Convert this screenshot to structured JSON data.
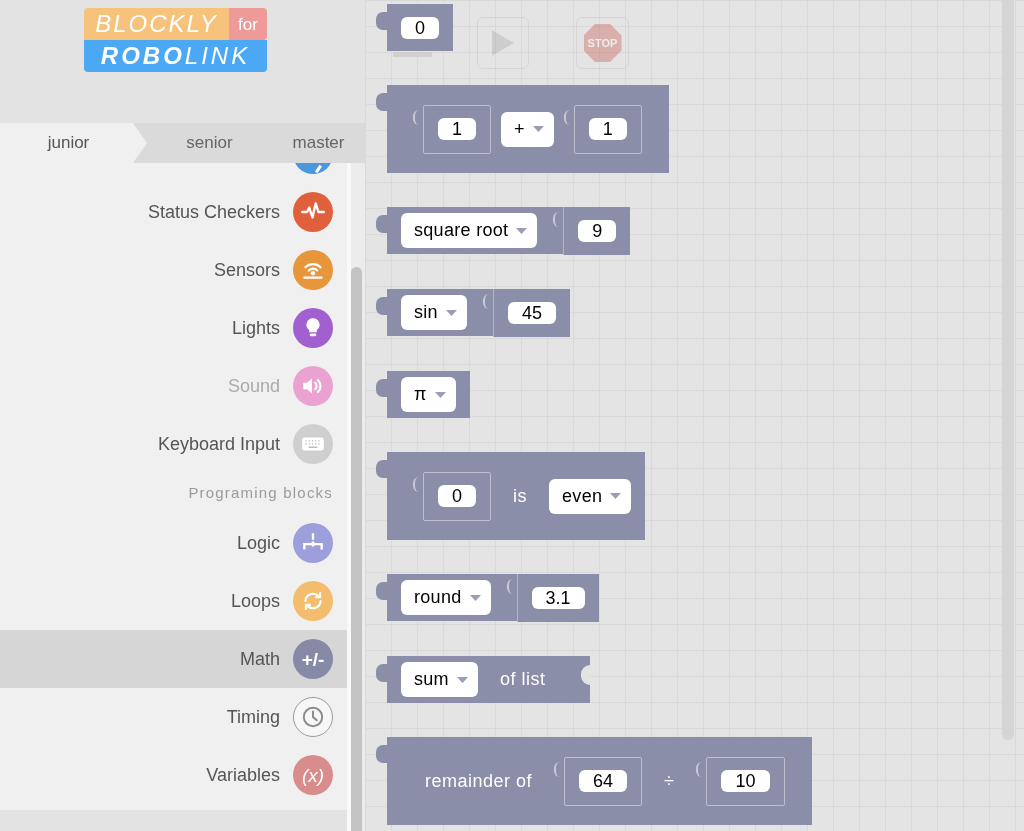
{
  "logo": {
    "top": "BLOCKLY",
    "badge": "for",
    "bottom": "**ROBO**LINK"
  },
  "tabs": [
    {
      "label": "junior",
      "selected": true
    },
    {
      "label": "senior",
      "selected": false
    },
    {
      "label": "master",
      "selected": false
    }
  ],
  "categories": [
    {
      "kind": "clipped",
      "color": "#4c96dd"
    },
    {
      "kind": "item",
      "label": "Status Checkers",
      "color": "#e0603b",
      "selected": false,
      "disabled": false
    },
    {
      "kind": "item",
      "label": "Sensors",
      "color": "#e8963c",
      "selected": false,
      "disabled": false
    },
    {
      "kind": "item",
      "label": "Lights",
      "color": "#a15fd0",
      "selected": false,
      "disabled": false
    },
    {
      "kind": "item",
      "label": "Sound",
      "color": "#eaa3d0",
      "selected": false,
      "disabled": true
    },
    {
      "kind": "item",
      "label": "Keyboard Input",
      "color": "#cfcfcf",
      "selected": false,
      "disabled": false
    },
    {
      "kind": "header",
      "label": "Programing blocks"
    },
    {
      "kind": "item",
      "label": "Logic",
      "color": "#9c9fdb",
      "selected": false,
      "disabled": false
    },
    {
      "kind": "item",
      "label": "Loops",
      "color": "#f3bd6d",
      "selected": false,
      "disabled": false
    },
    {
      "kind": "item",
      "label": "Math",
      "color": "#878aa6",
      "icon_text": "+/-",
      "selected": true,
      "disabled": false
    },
    {
      "kind": "item",
      "label": "Timing",
      "color": "#f7f7f7",
      "selected": false,
      "disabled": false
    },
    {
      "kind": "item",
      "label": "Variables",
      "color": "#d88c8c",
      "icon_text": "(x)",
      "selected": false,
      "disabled": false
    }
  ],
  "toolbar": {
    "play": {
      "disabled": true
    },
    "stop": {
      "label": "STOP",
      "disabled": true
    }
  },
  "blocks": [
    {
      "parts": [
        {
          "kind": "field",
          "text": "0"
        }
      ]
    },
    {
      "parts": [
        {
          "kind": "socket",
          "value": "1"
        },
        {
          "kind": "dropdown",
          "text": "+"
        },
        {
          "kind": "socket",
          "value": "1"
        }
      ]
    },
    {
      "parts": [
        {
          "kind": "dropdown",
          "text": "square root"
        }
      ],
      "attached": "9"
    },
    {
      "parts": [
        {
          "kind": "dropdown",
          "text": "sin"
        }
      ],
      "attached": "45"
    },
    {
      "parts": [
        {
          "kind": "dropdown",
          "text": "π"
        }
      ]
    },
    {
      "parts": [
        {
          "kind": "socket",
          "value": "0"
        },
        {
          "kind": "label",
          "text": "is"
        },
        {
          "kind": "dropdown",
          "text": "even"
        }
      ]
    },
    {
      "parts": [
        {
          "kind": "dropdown",
          "text": "round"
        }
      ],
      "attached": "3.1"
    },
    {
      "parts": [
        {
          "kind": "dropdown",
          "text": "sum"
        },
        {
          "kind": "label",
          "text": "of list"
        },
        {
          "kind": "notch"
        }
      ]
    },
    {
      "parts": [
        {
          "kind": "label",
          "text": "remainder of"
        },
        {
          "kind": "socket",
          "value": "64"
        },
        {
          "kind": "label",
          "text": "÷"
        },
        {
          "kind": "socket",
          "value": "10"
        }
      ]
    }
  ]
}
